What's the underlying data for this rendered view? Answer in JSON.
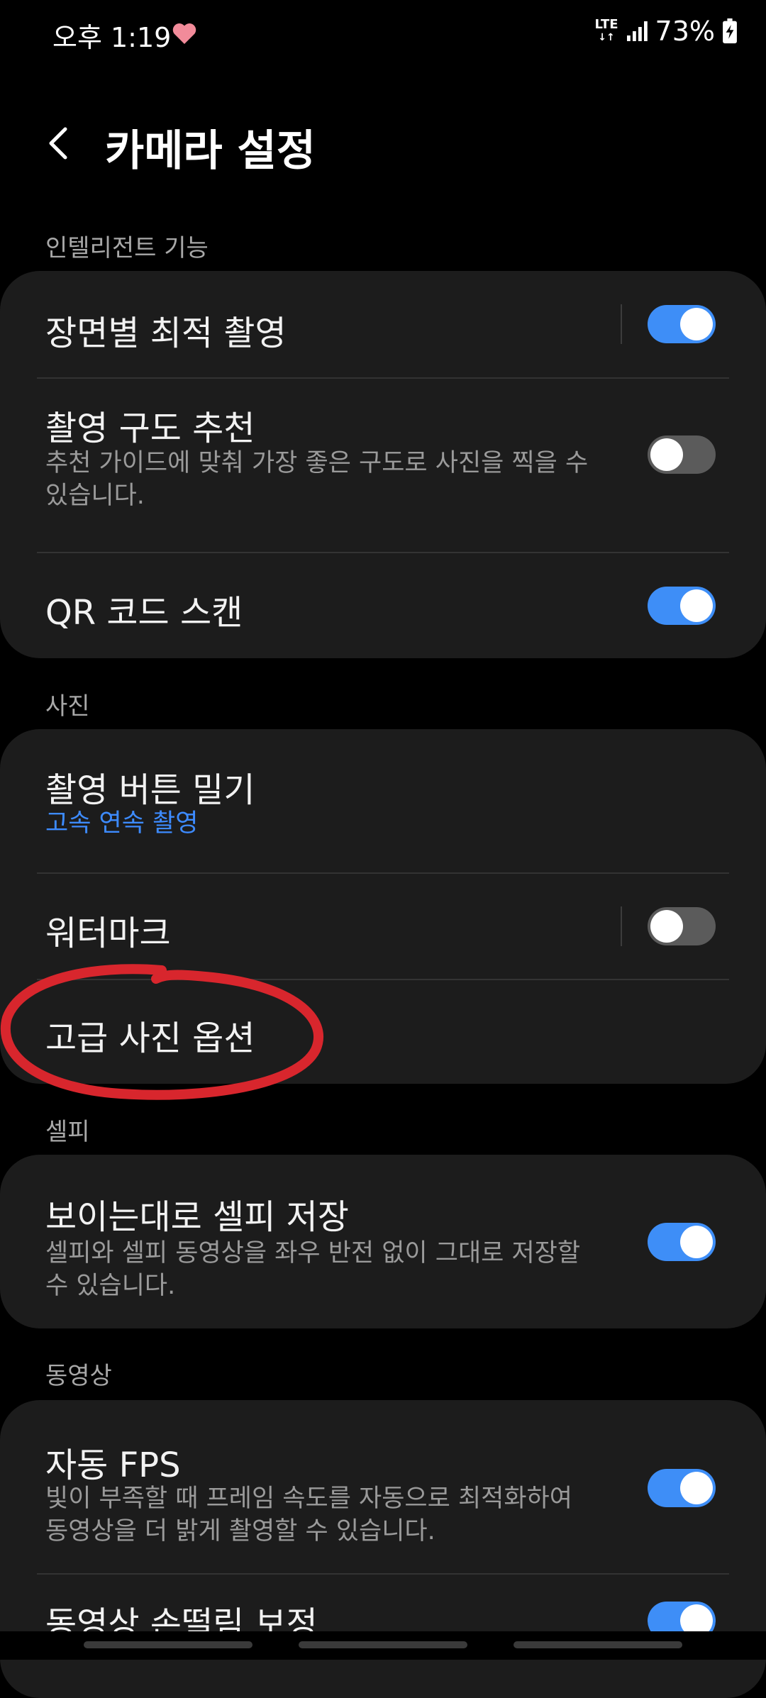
{
  "status_bar": {
    "time": "오후 1:19",
    "network": "LTE",
    "battery": "73%"
  },
  "header": {
    "title": "카메라 설정"
  },
  "sections": {
    "intelligent": {
      "label": "인텔리전트 기능",
      "scene_optimizer": {
        "title": "장면별 최적 촬영",
        "enabled": true
      },
      "shot_suggestions": {
        "title": "촬영 구도 추천",
        "description": "추천 가이드에 맞춰 가장 좋은 구도로 사진을 찍을 수 있습니다.",
        "enabled": false
      },
      "qr_scan": {
        "title": "QR 코드 스캔",
        "enabled": true
      }
    },
    "photo": {
      "label": "사진",
      "swipe_shutter": {
        "title": "촬영 버튼 밀기",
        "value": "고속 연속 촬영"
      },
      "watermark": {
        "title": "워터마크",
        "enabled": false
      },
      "advanced_options": {
        "title": "고급 사진 옵션"
      }
    },
    "selfie": {
      "label": "셀피",
      "save_as_previewed": {
        "title": "보이는대로 셀피 저장",
        "description": "셀피와 셀피 동영상을 좌우 반전 없이 그대로 저장할 수 있습니다.",
        "enabled": true
      }
    },
    "video": {
      "label": "동영상",
      "auto_fps": {
        "title": "자동 FPS",
        "description": "빛이 부족할 때 프레임 속도를 자동으로 최적화하여 동영상을 더 밝게 촬영할 수 있습니다.",
        "enabled": true
      },
      "stabilization": {
        "title": "동영상 손떨림 보정",
        "enabled": true
      }
    }
  },
  "colors": {
    "accent": "#3e8ef7",
    "link": "#3d8bff",
    "annotation": "#d8262d"
  }
}
